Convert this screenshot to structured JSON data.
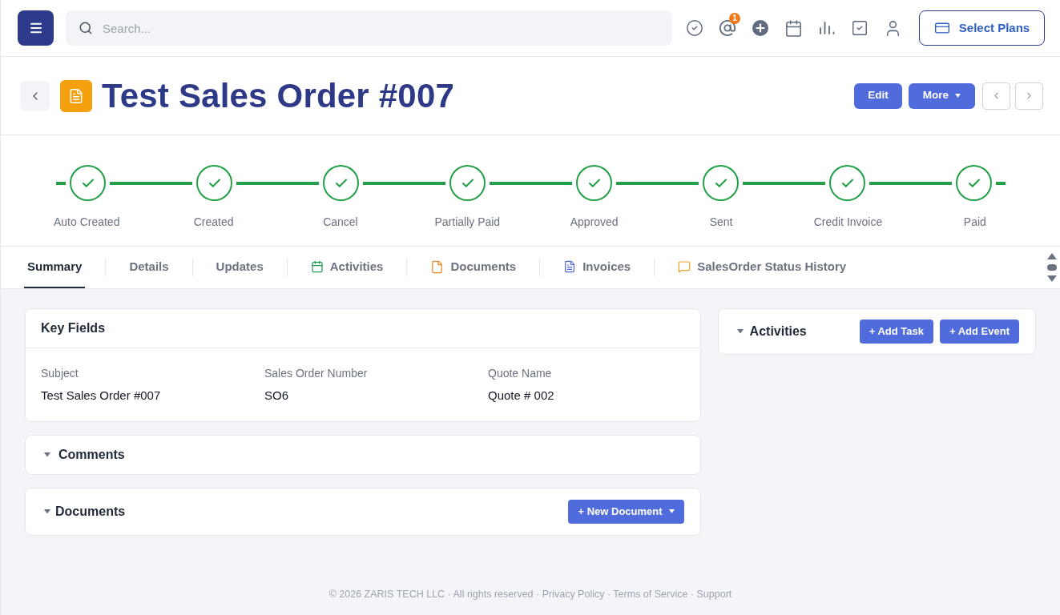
{
  "topbar": {
    "search": {
      "placeholder": "Search..."
    },
    "mention_badge": "1",
    "plans_button": "Select Plans"
  },
  "record": {
    "title": "Test Sales Order #007",
    "actions": [
      {
        "label": "Edit",
        "kind": "button"
      },
      {
        "label": "More",
        "kind": "dropdown"
      }
    ]
  },
  "stages": [
    {
      "label": "Auto Created",
      "completed": true
    },
    {
      "label": "Created",
      "completed": true
    },
    {
      "label": "Cancel",
      "completed": true
    },
    {
      "label": "Partially Paid",
      "completed": true
    },
    {
      "label": "Approved",
      "completed": true
    },
    {
      "label": "Sent",
      "completed": true
    },
    {
      "label": "Credit Invoice",
      "completed": true
    },
    {
      "label": "Paid",
      "completed": true
    }
  ],
  "tabs": [
    {
      "label": "Summary",
      "kind": "plain",
      "selected": true
    },
    {
      "label": "Details",
      "kind": "plain",
      "selected": false
    },
    {
      "label": "Updates",
      "kind": "plain",
      "selected": false
    },
    {
      "label": "Activities",
      "kind": "activities",
      "selected": false
    },
    {
      "label": "Documents",
      "kind": "documents",
      "selected": false
    },
    {
      "label": "Invoices",
      "kind": "invoices",
      "selected": false
    },
    {
      "label": "SalesOrder Status History",
      "kind": "history",
      "selected": false
    }
  ],
  "key_fields": {
    "title": "Key Fields",
    "fields": [
      {
        "label": "Subject",
        "value": "Test Sales Order #007"
      },
      {
        "label": "Sales Order Number",
        "value": "SO6"
      },
      {
        "label": "Quote Name",
        "value": "Quote # 002"
      }
    ]
  },
  "sections": [
    {
      "title": "Comments"
    },
    {
      "title": "Documents",
      "action": "+ New Document"
    }
  ],
  "activities": {
    "title": "Activities",
    "buttons": [
      "+ Add Task",
      "+ Add Event"
    ]
  },
  "footer": {
    "text": "© 2026 ZARIS TECH LLC · All rights reserved · Privacy Policy · Terms of Service · Support"
  }
}
